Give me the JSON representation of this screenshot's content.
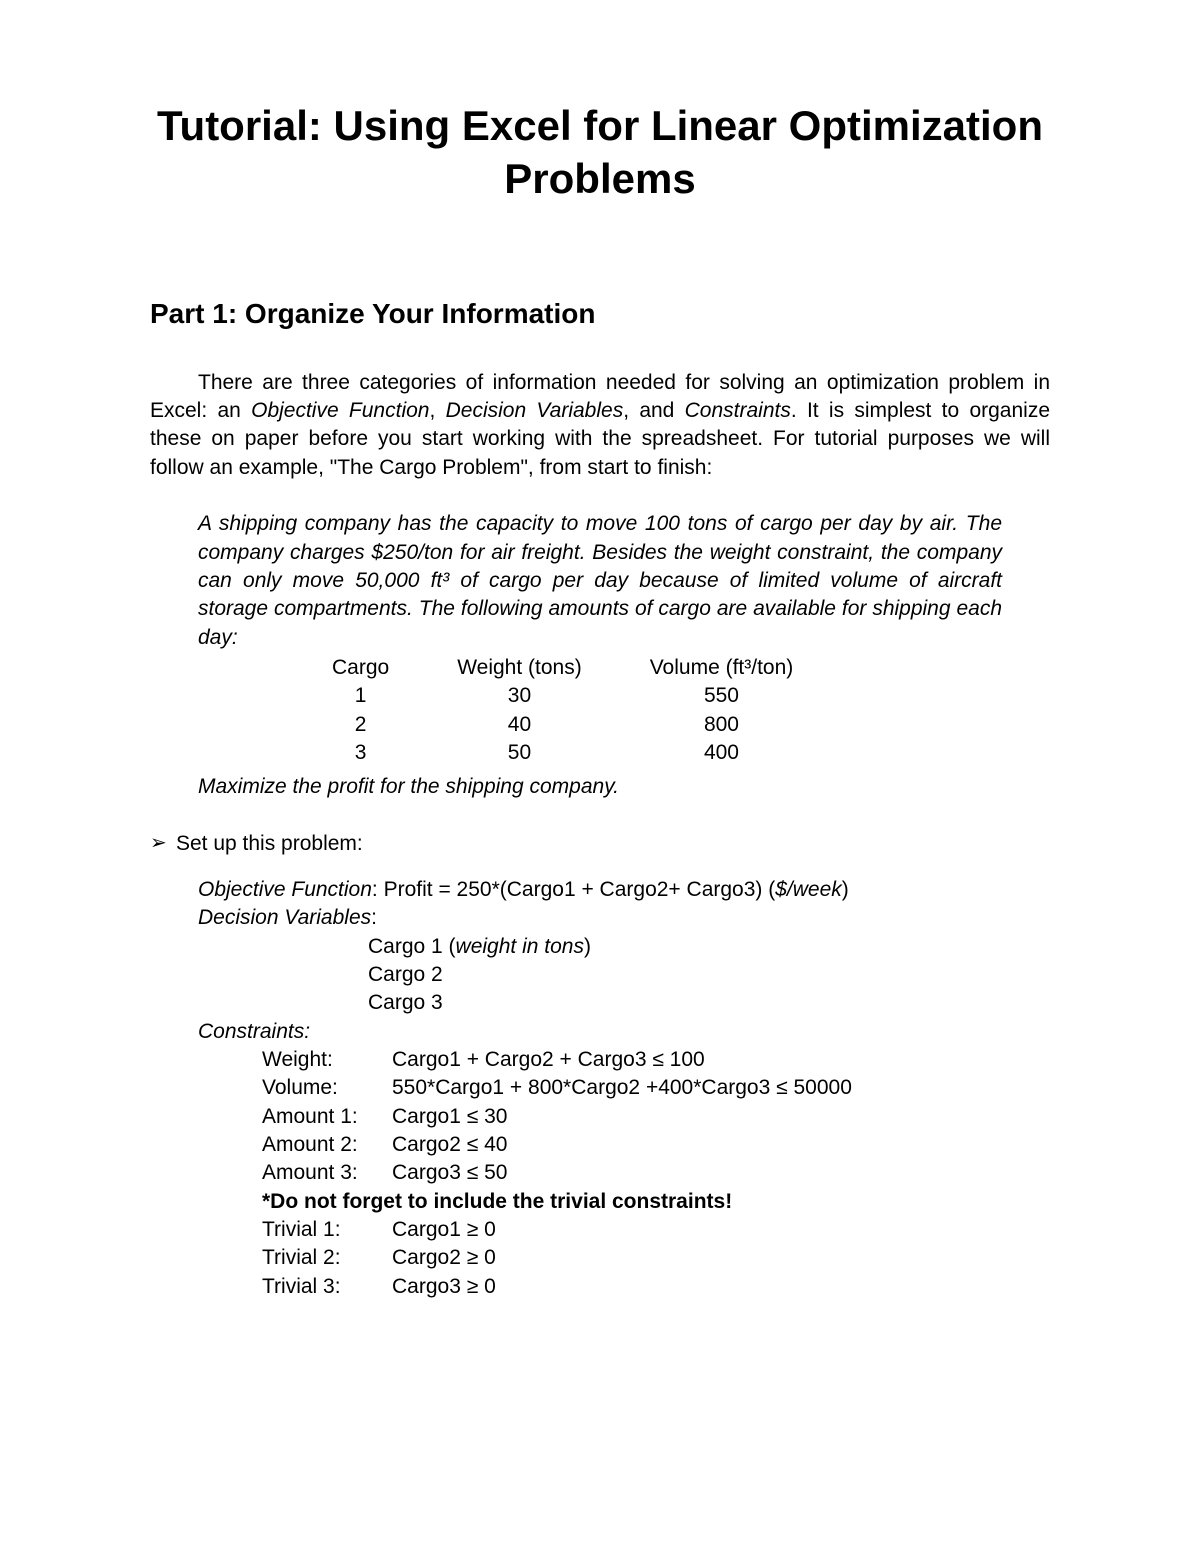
{
  "title": "Tutorial:  Using Excel for Linear Optimization Problems",
  "section_heading": "Part 1: Organize Your Information",
  "intro": {
    "pre": "There are three categories of information needed for solving an optimization problem in Excel: an ",
    "term1": "Objective Function",
    "sep1": ", ",
    "term2": "Decision Variables",
    "sep2": ", and ",
    "term3": "Constraints",
    "post": ". It is simplest to organize these on paper before you start working with the spreadsheet. For tutorial purposes we will follow an example, \"The Cargo Problem\", from start to finish:"
  },
  "problem_text": "A shipping company has the capacity to move 100 tons of cargo per day by air. The company charges $250/ton for air freight. Besides the weight constraint, the company can only move 50,000 ft³ of cargo per day because of limited volume of aircraft storage compartments. The following amounts of cargo are available for shipping each day:",
  "cargo_table": {
    "headers": [
      "Cargo",
      "Weight (tons)",
      "Volume (ft³/ton)"
    ],
    "rows": [
      [
        "1",
        "30",
        "550"
      ],
      [
        "2",
        "40",
        "800"
      ],
      [
        "3",
        "50",
        "400"
      ]
    ]
  },
  "maximize": "Maximize the profit for the shipping company.",
  "setup_label": "Set up this problem:",
  "objective": {
    "label": "Objective Function",
    "sep": ": ",
    "value_pre": "Profit = 250*(Cargo1 + Cargo2+ Cargo3) (",
    "unit": "$/week",
    "value_post": ")"
  },
  "decision_vars": {
    "label": "Decision Variables",
    "colon": ":",
    "line1_pre": "Cargo 1 (",
    "line1_em": "weight in tons",
    "line1_post": ")",
    "line2": "Cargo 2",
    "line3": "Cargo 3"
  },
  "constraints": {
    "label": "Constraints",
    "colon": ":",
    "rows": [
      {
        "name": "Weight:",
        "expr": "Cargo1 + Cargo2 + Cargo3 ≤ 100"
      },
      {
        "name": "Volume:",
        "expr": "550*Cargo1 + 800*Cargo2 +400*Cargo3 ≤ 50000"
      },
      {
        "name": "Amount 1:",
        "expr": "Cargo1 ≤ 30"
      },
      {
        "name": "Amount 2:",
        "expr": "Cargo2 ≤ 40"
      },
      {
        "name": "Amount 3:",
        "expr": "Cargo3 ≤ 50"
      }
    ],
    "reminder": "*Do not forget to include the trivial constraints!",
    "trivial": [
      {
        "name": "Trivial 1:",
        "expr": "Cargo1 ≥ 0"
      },
      {
        "name": "Trivial 2:",
        "expr": "Cargo2 ≥ 0"
      },
      {
        "name": "Trivial 3:",
        "expr": "Cargo3 ≥ 0"
      }
    ]
  }
}
